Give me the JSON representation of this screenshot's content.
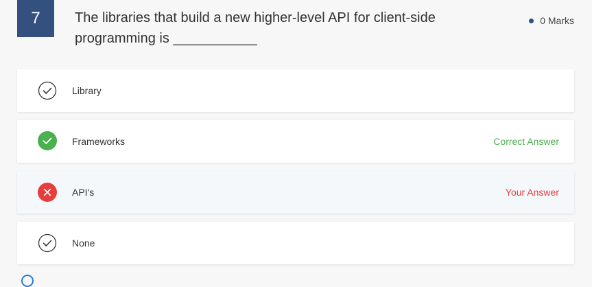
{
  "question": {
    "number": "7",
    "text": "The libraries that build a new higher-level API for client-side programming is ___________",
    "marks": "0 Marks"
  },
  "options": [
    {
      "label": "Library",
      "tag": "",
      "state": "neutral"
    },
    {
      "label": "Frameworks",
      "tag": "Correct Answer",
      "state": "correct"
    },
    {
      "label": "API's",
      "tag": "Your Answer",
      "state": "wrong"
    },
    {
      "label": "None",
      "tag": "",
      "state": "neutral"
    }
  ],
  "colors": {
    "accent": "#34507f",
    "correct": "#4caf50",
    "wrong": "#e53e3e"
  },
  "icons": {
    "neutral": "check-circle-outline-icon",
    "correct": "check-circle-filled-icon",
    "wrong": "x-circle-filled-icon"
  }
}
